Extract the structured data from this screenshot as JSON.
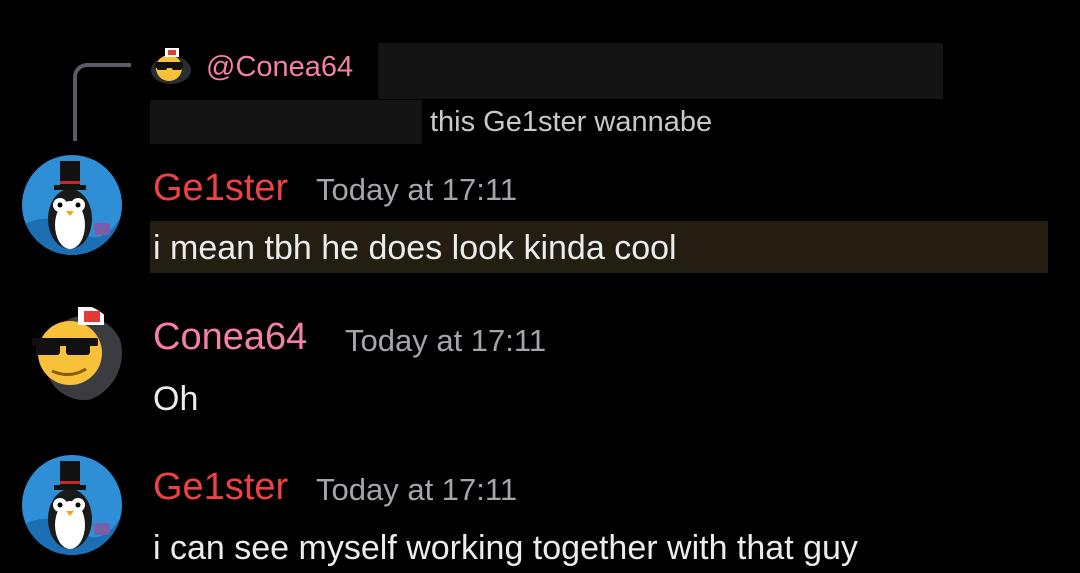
{
  "reply": {
    "author": "@Conea64",
    "text": "this Ge1ster wannabe"
  },
  "messages": [
    {
      "author": "Ge1ster",
      "timestamp": "Today at 17:11",
      "text": "i mean tbh he does look kinda cool",
      "author_color": "#ed4245",
      "avatar": "penguin-top-hat-avatar",
      "highlighted": true
    },
    {
      "author": "Conea64",
      "timestamp": "Today at 17:11",
      "text": "Oh",
      "author_color": "#f47fa9",
      "avatar": "sunglasses-emoji-avatar",
      "highlighted": false
    },
    {
      "author": "Ge1ster",
      "timestamp": "Today at 17:11",
      "text": "i can see myself working together with that guy",
      "author_color": "#ed4245",
      "avatar": "penguin-top-hat-avatar",
      "highlighted": false
    }
  ],
  "colors": {
    "background": "#000000",
    "highlight": "#241e12",
    "timestamp": "#a3a6aa"
  }
}
